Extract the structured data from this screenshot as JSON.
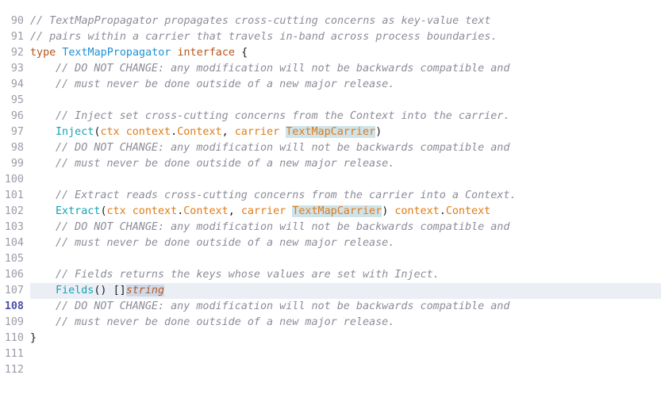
{
  "lines": [
    {
      "num": "90"
    },
    {
      "num": "91",
      "comment": "// TextMapPropagator propagates cross-cutting concerns as key-value text"
    },
    {
      "num": "92",
      "comment": "// pairs within a carrier that travels in-band across process boundaries."
    },
    {
      "num": "93",
      "kw_type": "type",
      "name": "TextMapPropagator",
      "kw_interface": "interface",
      "brace": "{"
    },
    {
      "num": "94",
      "comment": "// DO NOT CHANGE: any modification will not be backwards compatible and"
    },
    {
      "num": "95",
      "comment": "// must never be done outside of a new major release."
    },
    {
      "num": "96"
    },
    {
      "num": "97",
      "comment": "// Inject set cross-cutting concerns from the Context into the carrier."
    },
    {
      "num": "98",
      "fn": "Inject",
      "open": "(",
      "p1": "ctx",
      "pkg": "context",
      "dot": ".",
      "ty": "Context",
      "comma": ", ",
      "p2": "carrier",
      "ty2": "TextMapCarrier",
      "close": ")"
    },
    {
      "num": "99",
      "comment": "// DO NOT CHANGE: any modification will not be backwards compatible and"
    },
    {
      "num": "100",
      "comment": "// must never be done outside of a new major release."
    },
    {
      "num": "101"
    },
    {
      "num": "102",
      "comment": "// Extract reads cross-cutting concerns from the carrier into a Context."
    },
    {
      "num": "103",
      "fn": "Extract",
      "open": "(",
      "p1": "ctx",
      "pkg": "context",
      "dot": ".",
      "ty": "Context",
      "comma": ", ",
      "p2": "carrier",
      "ty2": "TextMapCarrier",
      "close": ")",
      "rpkg": "context",
      "rdot": ".",
      "rty": "Context"
    },
    {
      "num": "104",
      "comment": "// DO NOT CHANGE: any modification will not be backwards compatible and"
    },
    {
      "num": "105",
      "comment": "// must never be done outside of a new major release."
    },
    {
      "num": "106"
    },
    {
      "num": "107",
      "comment": "// Fields returns the keys whose values are set with Inject."
    },
    {
      "num": "108",
      "fn": "Fields",
      "parens": "()",
      "brackets": "[]",
      "ret": "string"
    },
    {
      "num": "109",
      "comment": "// DO NOT CHANGE: any modification will not be backwards compatible and"
    },
    {
      "num": "110",
      "comment": "// must never be done outside of a new major release."
    },
    {
      "num": "111",
      "brace": "}"
    },
    {
      "num": "112"
    }
  ],
  "colors": {
    "comment": "#8c8c9a",
    "keyword": "#b5561a",
    "type_name": "#1f8fd6",
    "function": "#16a3b5",
    "param": "#e07b14",
    "highlight": "#cfe3ea",
    "current_line": "#eceef6"
  }
}
